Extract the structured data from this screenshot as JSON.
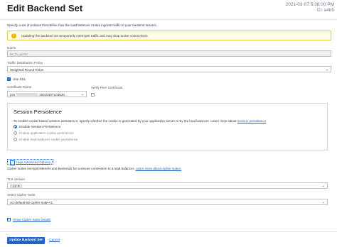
{
  "header": {
    "title": "Edit Backend Set",
    "timestamp": "2021-03-07 5:38:00 PM",
    "timestamp_sub": "Cl: a4b5"
  },
  "intro_text": "Specify a set of policies that define how the load balancer routes ingress traffic to your backend servers.",
  "warning": {
    "icon": "warning-icon",
    "text": "Updating the backend set temporarily interrupts traffic and may drop active connections."
  },
  "name_field": {
    "label": "Name",
    "value": "bs_lb_acme"
  },
  "policy_field": {
    "label": "Traffic Distribution Policy",
    "value": "Weighted Round Robin"
  },
  "use_ssl": {
    "label": "Use SSL",
    "checked": true
  },
  "certificate": {
    "label": "Certificate Name",
    "value_prefix": "pvs",
    "value_suffix": "20210307103620"
  },
  "verify_peer": {
    "label": "Verify Peer Certificate",
    "checked": false
  },
  "session": {
    "title": "Session Persistence",
    "desc": "To enable cookie-based session persistence, specify whether the cookie is generated by your application server or by the load balancer. Learn more about",
    "desc_link": "session persistence",
    "options": [
      {
        "label": "Disable Session Persistence",
        "selected": true
      },
      {
        "label": "Enable application cookie persistence",
        "selected": false
      },
      {
        "label": "Enable load balancer cookie persistence",
        "selected": false
      }
    ]
  },
  "advanced": {
    "toggle_label": "Hide Advanced Options",
    "cipher_desc": "Cipher suites encrypt listeners and backends for a secure connection to a load balancer.",
    "cipher_link": "Learn more about cipher suites.",
    "tls": {
      "label": "TLS Version",
      "tag": "1.2",
      "tag_remove": "✕"
    },
    "cipher_suite": {
      "label": "Select Cipher Suite",
      "value": "oci-default-ssl-cipher-suite-v1"
    },
    "show_details": "Show Cipher Suite Details"
  },
  "footer": {
    "primary": "Update Backend Set",
    "cancel": "Cancel"
  },
  "colors": {
    "accent": "#1f66c4",
    "warning_border": "#e8c94a",
    "warning_bg": "#fffde8"
  }
}
